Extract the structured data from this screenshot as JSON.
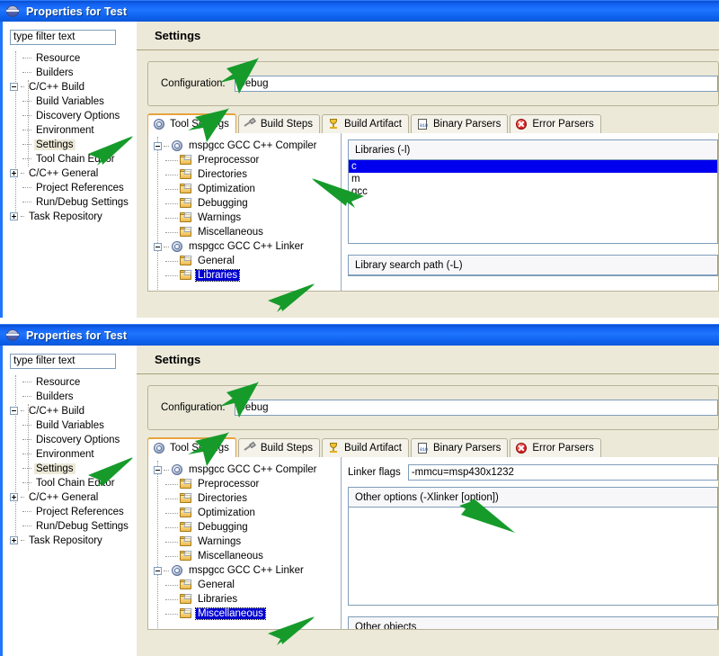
{
  "windows": [
    {
      "title": "Properties for Test",
      "titlebar_icon": "globe-icon",
      "filter": {
        "value": "type filter text",
        "placeholder": "type filter text"
      },
      "tree": [
        {
          "label": "Resource",
          "depth": 1,
          "expander": "none"
        },
        {
          "label": "Builders",
          "depth": 1,
          "expander": "none"
        },
        {
          "label": "C/C++ Build",
          "depth": 0,
          "expander": "minus"
        },
        {
          "label": "Build Variables",
          "depth": 1,
          "expander": "none"
        },
        {
          "label": "Discovery Options",
          "depth": 1,
          "expander": "none"
        },
        {
          "label": "Environment",
          "depth": 1,
          "expander": "none"
        },
        {
          "label": "Settings",
          "depth": 1,
          "expander": "none",
          "selected": true
        },
        {
          "label": "Tool Chain Editor",
          "depth": 1,
          "expander": "none"
        },
        {
          "label": "C/C++ General",
          "depth": 0,
          "expander": "plus"
        },
        {
          "label": "Project References",
          "depth": 1,
          "expander": "none"
        },
        {
          "label": "Run/Debug Settings",
          "depth": 1,
          "expander": "none"
        },
        {
          "label": "Task Repository",
          "depth": 0,
          "expander": "plus"
        }
      ],
      "page_title": "Settings",
      "configuration": {
        "label": "Configuration:",
        "value": "Debug"
      },
      "tabs": [
        {
          "label": "Tool Settings",
          "icon": "wrench-icon",
          "active": true
        },
        {
          "label": "Build Steps",
          "icon": "hammer-icon",
          "active": false
        },
        {
          "label": "Build Artifact",
          "icon": "trophy-icon",
          "active": false
        },
        {
          "label": "Binary Parsers",
          "icon": "document-icon",
          "active": false
        },
        {
          "label": "Error Parsers",
          "icon": "error-icon",
          "active": false
        }
      ],
      "tool_tree": [
        {
          "label": "mspgcc GCC C++ Compiler",
          "depth": 0,
          "icon": "gear-icon",
          "expander": "minus"
        },
        {
          "label": "Preprocessor",
          "depth": 1,
          "icon": "folder-icon",
          "expander": "none"
        },
        {
          "label": "Directories",
          "depth": 1,
          "icon": "folder-icon",
          "expander": "none"
        },
        {
          "label": "Optimization",
          "depth": 1,
          "icon": "folder-icon",
          "expander": "none"
        },
        {
          "label": "Debugging",
          "depth": 1,
          "icon": "folder-icon",
          "expander": "none"
        },
        {
          "label": "Warnings",
          "depth": 1,
          "icon": "folder-icon",
          "expander": "none"
        },
        {
          "label": "Miscellaneous",
          "depth": 1,
          "icon": "folder-icon",
          "expander": "none"
        },
        {
          "label": "mspgcc GCC C++ Linker",
          "depth": 0,
          "icon": "gear-icon",
          "expander": "minus"
        },
        {
          "label": "General",
          "depth": 1,
          "icon": "folder-icon",
          "expander": "none"
        },
        {
          "label": "Libraries",
          "depth": 1,
          "icon": "folder-icon",
          "expander": "none",
          "selected": true
        }
      ],
      "options": {
        "libraries_header": "Libraries (-l)",
        "libraries": [
          {
            "name": "c",
            "selected": true
          },
          {
            "name": "m",
            "selected": false
          },
          {
            "name": "gcc",
            "selected": false
          }
        ],
        "search_path_header": "Library search path (-L)"
      }
    },
    {
      "title": "Properties for Test",
      "titlebar_icon": "globe-icon",
      "filter": {
        "value": "type filter text",
        "placeholder": "type filter text"
      },
      "tree": [
        {
          "label": "Resource",
          "depth": 1,
          "expander": "none"
        },
        {
          "label": "Builders",
          "depth": 1,
          "expander": "none"
        },
        {
          "label": "C/C++ Build",
          "depth": 0,
          "expander": "minus"
        },
        {
          "label": "Build Variables",
          "depth": 1,
          "expander": "none"
        },
        {
          "label": "Discovery Options",
          "depth": 1,
          "expander": "none"
        },
        {
          "label": "Environment",
          "depth": 1,
          "expander": "none"
        },
        {
          "label": "Settings",
          "depth": 1,
          "expander": "none",
          "selected": true
        },
        {
          "label": "Tool Chain Editor",
          "depth": 1,
          "expander": "none"
        },
        {
          "label": "C/C++ General",
          "depth": 0,
          "expander": "plus"
        },
        {
          "label": "Project References",
          "depth": 1,
          "expander": "none"
        },
        {
          "label": "Run/Debug Settings",
          "depth": 1,
          "expander": "none"
        },
        {
          "label": "Task Repository",
          "depth": 0,
          "expander": "plus"
        }
      ],
      "page_title": "Settings",
      "configuration": {
        "label": "Configuration:",
        "value": "Debug"
      },
      "tabs": [
        {
          "label": "Tool Settings",
          "icon": "wrench-icon",
          "active": true
        },
        {
          "label": "Build Steps",
          "icon": "hammer-icon",
          "active": false
        },
        {
          "label": "Build Artifact",
          "icon": "trophy-icon",
          "active": false
        },
        {
          "label": "Binary Parsers",
          "icon": "document-icon",
          "active": false
        },
        {
          "label": "Error Parsers",
          "icon": "error-icon",
          "active": false
        }
      ],
      "tool_tree": [
        {
          "label": "mspgcc GCC C++ Compiler",
          "depth": 0,
          "icon": "gear-icon",
          "expander": "minus"
        },
        {
          "label": "Preprocessor",
          "depth": 1,
          "icon": "folder-icon",
          "expander": "none"
        },
        {
          "label": "Directories",
          "depth": 1,
          "icon": "folder-icon",
          "expander": "none"
        },
        {
          "label": "Optimization",
          "depth": 1,
          "icon": "folder-icon",
          "expander": "none"
        },
        {
          "label": "Debugging",
          "depth": 1,
          "icon": "folder-icon",
          "expander": "none"
        },
        {
          "label": "Warnings",
          "depth": 1,
          "icon": "folder-icon",
          "expander": "none"
        },
        {
          "label": "Miscellaneous",
          "depth": 1,
          "icon": "folder-icon",
          "expander": "none"
        },
        {
          "label": "mspgcc GCC C++ Linker",
          "depth": 0,
          "icon": "gear-icon",
          "expander": "minus"
        },
        {
          "label": "General",
          "depth": 1,
          "icon": "folder-icon",
          "expander": "none"
        },
        {
          "label": "Libraries",
          "depth": 1,
          "icon": "folder-icon",
          "expander": "none"
        },
        {
          "label": "Miscellaneous",
          "depth": 1,
          "icon": "folder-icon",
          "expander": "none",
          "selected": true
        }
      ],
      "options": {
        "linker_flags_label": "Linker flags",
        "linker_flags_value": "-mmcu=msp430x1232",
        "other_options_header": "Other options (-Xlinker [option])",
        "other_objects_header": "Other objects"
      }
    }
  ],
  "annotations": {
    "arrow_color": "#169b2b",
    "arrows": [
      {
        "target": "configuration-input",
        "window": 0
      },
      {
        "target": "tab-tool-settings",
        "window": 0
      },
      {
        "target": "sidebar-item-settings",
        "window": 0
      },
      {
        "target": "library-item-c",
        "window": 0
      },
      {
        "target": "tool-tree-libraries",
        "window": 0
      },
      {
        "target": "configuration-input",
        "window": 1
      },
      {
        "target": "tab-tool-settings",
        "window": 1
      },
      {
        "target": "sidebar-item-settings",
        "window": 1
      },
      {
        "target": "linker-flags-input",
        "window": 1
      },
      {
        "target": "tool-tree-miscellaneous",
        "window": 1
      }
    ]
  },
  "colors": {
    "titlebar": "#1f75ff",
    "panel": "#ece9d8",
    "selection": "#0000ee",
    "active_tab_accent": "#e8a33d",
    "arrow_green": "#169b2b"
  }
}
